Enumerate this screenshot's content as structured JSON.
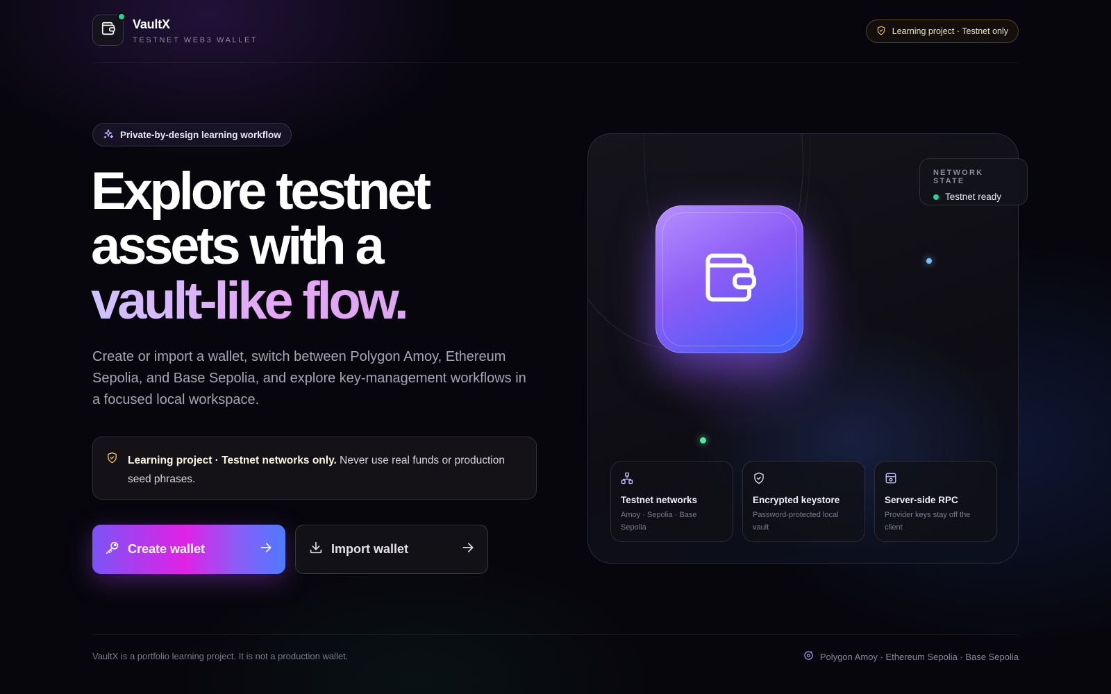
{
  "header": {
    "brand_name": "VaultX",
    "brand_subtitle": "TESTNET WEB3 WALLET",
    "learning_pill": "Learning project · Testnet only"
  },
  "hero": {
    "badge": "Private-by-design learning workflow",
    "headline_line1": "Explore testnet",
    "headline_line2": "assets with a",
    "headline_line3": "vault-like flow.",
    "description": "Create or import a wallet, switch between Polygon Amoy, Ethereum Sepolia, and Base Sepolia, and explore key-management workflows in a focused local workspace."
  },
  "notice": {
    "bold_text": "Learning project · Testnet networks only.",
    "text": " Never use real funds or production seed phrases."
  },
  "actions": {
    "create_label": "Create wallet",
    "import_label": "Import wallet"
  },
  "network_state": {
    "title": "NETWORK STATE",
    "status": "Testnet ready"
  },
  "features": [
    {
      "icon": "network-icon",
      "title": "Testnet networks",
      "desc": "Amoy · Sepolia · Base Sepolia"
    },
    {
      "icon": "shield-icon",
      "title": "Encrypted keystore",
      "desc": "Password-protected local vault"
    },
    {
      "icon": "server-icon",
      "title": "Server-side RPC",
      "desc": "Provider keys stay off the client"
    }
  ],
  "footer": {
    "disclaimer": "VaultX is a portfolio learning project. It is not a production wallet.",
    "networks": "Polygon Amoy · Ethereum Sepolia · Base Sepolia"
  },
  "colors": {
    "accent_green": "#22d3a0",
    "accent_purple": "#8c5cf6",
    "accent_blue": "#3f63ff",
    "accent_pink": "#e022e6",
    "warning_gold": "#e6be50"
  }
}
